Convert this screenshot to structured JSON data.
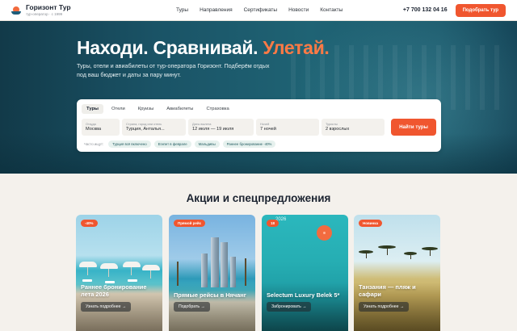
{
  "header": {
    "brand": "Горизонт Тур",
    "tagline": "тур-оператор · с 1999",
    "nav": [
      "Туры",
      "Направления",
      "Сертификаты",
      "Новости",
      "Контакты"
    ],
    "phone": "+7 700 132 04 16",
    "cta": "Подобрать тур"
  },
  "hero": {
    "title_main": "Находи. Сравнивай. ",
    "title_accent": "Улетай.",
    "subtitle": "Туры, отели и авиабилеты от тур-оператора Горизонт. Подберём отдых под ваш бюджет и даты за пару минут."
  },
  "search": {
    "tabs": [
      "Туры",
      "Отели",
      "Круизы",
      "Авиабилеты",
      "Страховка"
    ],
    "fields": [
      {
        "label": "Откуда",
        "value": "Москва"
      },
      {
        "label": "Страна, город или отель",
        "value": "Турция, Анталья..."
      },
      {
        "label": "Даты вылета",
        "value": "12 июля — 19 июля"
      },
      {
        "label": "Ночей",
        "value": "7 ночей"
      },
      {
        "label": "Туристы",
        "value": "2 взрослых"
      }
    ],
    "submit": "Найти туры",
    "chips_label": "Часто ищут:",
    "chips": [
      "Турция всё включено",
      "Египет в феврале",
      "Мальдивы",
      "Раннее бронирование -40%"
    ]
  },
  "promos": {
    "title": "Акции и спецпредложения",
    "cards": [
      {
        "badge": "-40%",
        "title": "Раннее бронирование лета 2026",
        "button": "Узнать подробнее →"
      },
      {
        "badge": "Прямой рейс",
        "title": "Прямые рейсы в Нячанг",
        "button": "Подобрать →"
      },
      {
        "badge": "18",
        "overlay": "2026",
        "title": "Selectum Luxury Belek 5*",
        "button": "Забронировать →"
      },
      {
        "badge": "Новинка",
        "title": "Танзания — пляж и сафари",
        "button": "Узнать подробнее →"
      }
    ]
  },
  "colors": {
    "accent": "#f0562f",
    "hero": "#1a5366",
    "brand_dark": "#1b2330"
  }
}
